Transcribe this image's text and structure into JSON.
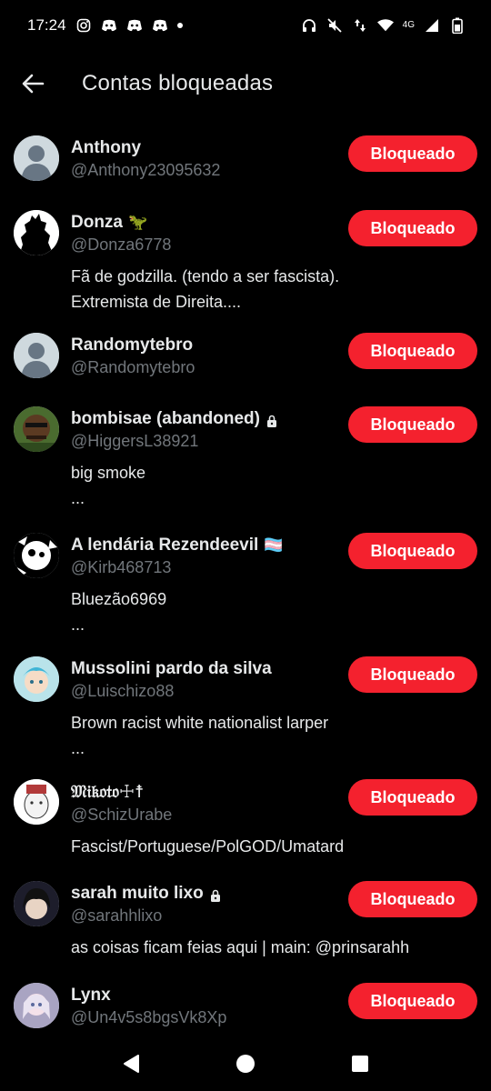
{
  "status_bar": {
    "time": "17:24",
    "network": "4G"
  },
  "header": {
    "title": "Contas bloqueadas"
  },
  "button_label": "Bloqueado",
  "accounts": [
    {
      "name": "Anthony",
      "handle": "@Anthony23095632",
      "bio": [],
      "emoji": "",
      "locked": false,
      "avatar": "default-avatar"
    },
    {
      "name": "Donza",
      "handle": "@Donza6778",
      "bio": [
        "Fã de godzilla. (tendo a ser fascista).",
        "Extremista de Direita...."
      ],
      "emoji": "🦖",
      "locked": false,
      "avatar": "godzilla-avatar"
    },
    {
      "name": "Randomytebro",
      "handle": "@Randomytebro",
      "bio": [],
      "emoji": "",
      "locked": false,
      "avatar": "default-avatar"
    },
    {
      "name": "bombisae (abandoned)",
      "handle": "@HiggersL38921",
      "bio": [
        "big smoke",
        "..."
      ],
      "emoji": "",
      "locked": true,
      "avatar": "big-smoke-avatar"
    },
    {
      "name": "A lendária Rezendeevil",
      "handle": "@Kirb468713",
      "bio": [
        "Bluezão6969",
        "..."
      ],
      "emoji": "🏳️‍⚧️",
      "locked": false,
      "avatar": "bw-art-avatar"
    },
    {
      "name": "Mussolini pardo da silva",
      "handle": "@Luischizo88",
      "bio": [
        "Brown racist white nationalist larper",
        "..."
      ],
      "emoji": "",
      "locked": false,
      "avatar": "anime-avatar"
    },
    {
      "name": "𝔐𝔦𝔨𝔬𝔱𝔬☩☨",
      "handle": "@SchizUrabe",
      "bio": [
        "Fascist/Portuguese/PolGOD/Umatard"
      ],
      "emoji": "",
      "locked": false,
      "avatar": "wojak-avatar"
    },
    {
      "name": "sarah muito lixo",
      "handle": "@sarahhlixo",
      "bio": [
        "as coisas ficam feias aqui | main: @prinsarahh"
      ],
      "emoji": "",
      "locked": true,
      "avatar": "dark-hair-avatar"
    },
    {
      "name": "Lynx",
      "handle": "@Un4v5s8bgsVk8Xp",
      "bio": [],
      "emoji": "",
      "locked": false,
      "avatar": "doll-avatar"
    }
  ],
  "colors": {
    "background": "#000000",
    "button": "#f4212e",
    "handle": "#71767b",
    "text": "#e7e9ea"
  }
}
